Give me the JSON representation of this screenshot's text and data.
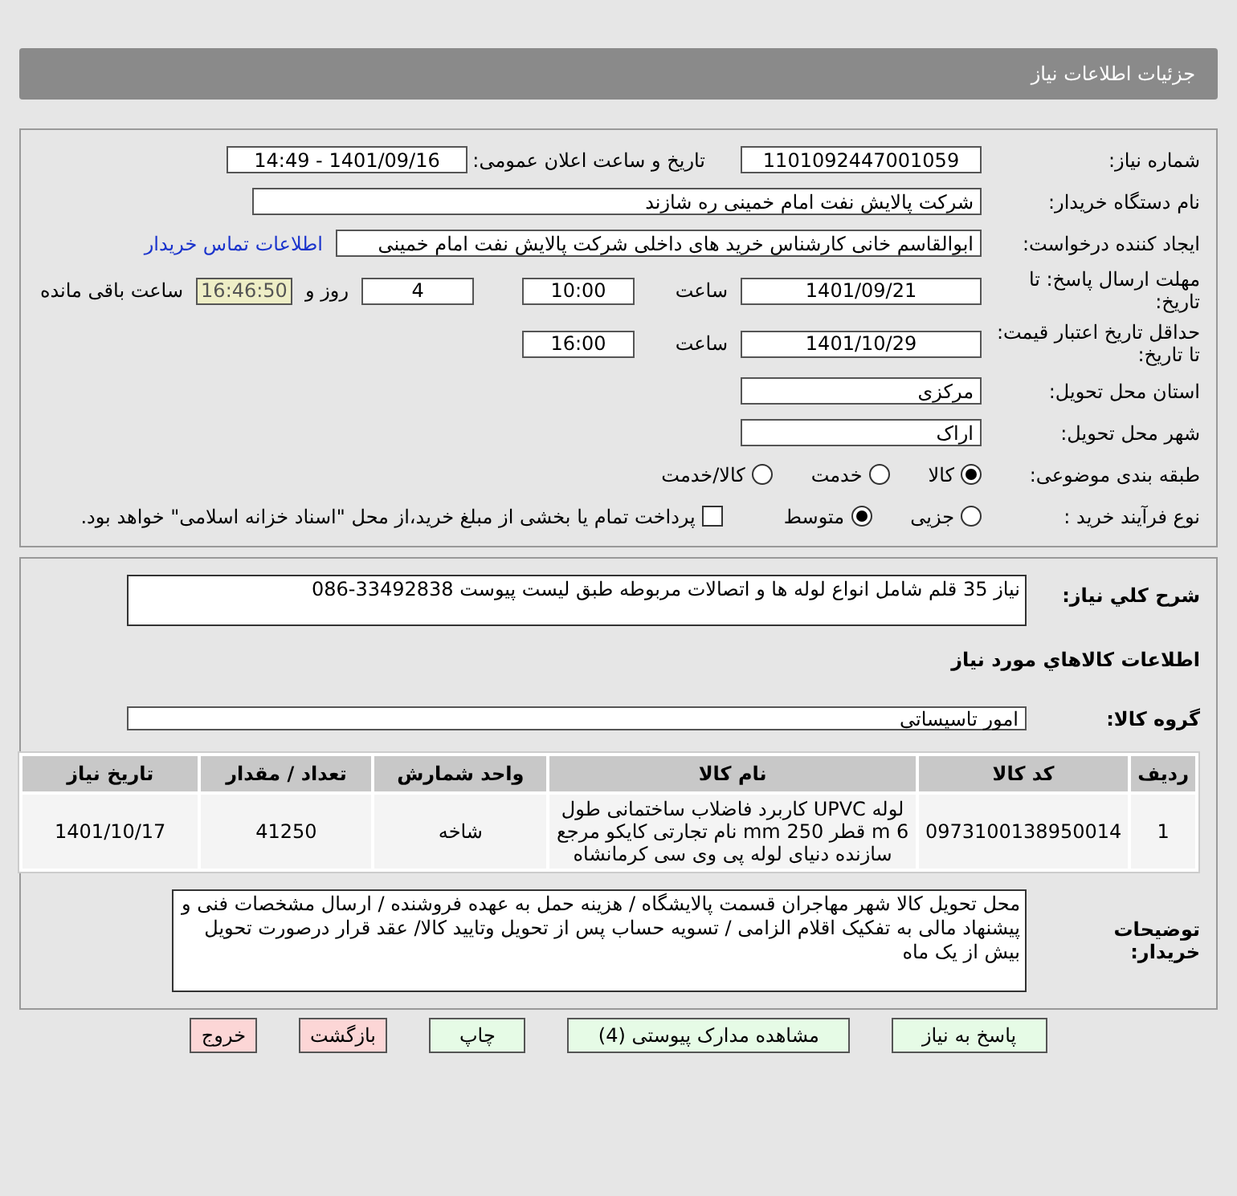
{
  "header": {
    "title": "جزئیات اطلاعات نیاز"
  },
  "need_number": {
    "label": "شماره نیاز:",
    "value": "1101092447001059"
  },
  "announce": {
    "label": "تاریخ و ساعت اعلان عمومی:",
    "value": "1401/09/16 - 14:49"
  },
  "buyer_org": {
    "label": "نام دستگاه خریدار:",
    "value": "شرکت پالایش نفت امام خمینی  ره  شازند"
  },
  "requester": {
    "label": "ایجاد کننده درخواست:",
    "value": "ابوالقاسم  خانی  کارشناس خرید های داخلی  شرکت پالایش نفت امام خمینی",
    "link": "اطلاعات تماس خریدار"
  },
  "deadline": {
    "label": "مهلت ارسال پاسخ: تا تاریخ:",
    "date": "1401/09/21",
    "time_label": "ساعت",
    "time": "10:00",
    "days": "4",
    "days_label": "روز و",
    "remaining": "16:46:50",
    "remaining_label": "ساعت باقی مانده"
  },
  "validity": {
    "label": "حداقل تاریخ اعتبار قیمت: تا تاریخ:",
    "date": "1401/10/29",
    "time_label": "ساعت",
    "time": "16:00"
  },
  "province": {
    "label": "استان محل تحویل:",
    "value": "مرکزی"
  },
  "city": {
    "label": "شهر محل تحویل:",
    "value": "اراک"
  },
  "category": {
    "label": "طبقه بندی موضوعی:",
    "options": [
      {
        "label": "کالا",
        "selected": true
      },
      {
        "label": "خدمت",
        "selected": false
      },
      {
        "label": "کالا/خدمت",
        "selected": false
      }
    ]
  },
  "process": {
    "label": "نوع فرآیند خرید :",
    "options": [
      {
        "label": "جزیی",
        "selected": false
      },
      {
        "label": "متوسط",
        "selected": true
      }
    ],
    "treasury": {
      "label": "پرداخت تمام یا بخشی از مبلغ خرید،از محل \"اسناد خزانه اسلامی\" خواهد بود.",
      "checked": false
    }
  },
  "description": {
    "label": "شرح کلي نياز:",
    "value": "نیاز 35 قلم شامل انواع لوله ها و اتصالات مربوطه طبق لیست پیوست 33492838-086"
  },
  "goods_heading": "اطلاعات کالاهاي مورد نياز",
  "goods_group": {
    "label": "گروه کالا:",
    "value": "امور تاسیساتی"
  },
  "table": {
    "columns": [
      "ردیف",
      "کد کالا",
      "نام کالا",
      "واحد شمارش",
      "تعداد / مقدار",
      "تاریخ نیاز"
    ],
    "rows": [
      [
        "1",
        "0973100138950014",
        "لوله UPVC کاربرد فاضلاب ساختمانی طول 6 m قطر 250 mm نام تجارتی کایکو مرجع سازنده دنیای لوله پی وی سی کرمانشاه",
        "شاخه",
        "41250",
        "1401/10/17"
      ]
    ]
  },
  "notes": {
    "label": "توضیحات خریدار:",
    "value": "محل تحویل کالا شهر مهاجران  قسمت پالایشگاه / هزینه حمل به عهده فروشنده / ارسال مشخصات فنی و پیشنهاد مالی به تفکیک اقلام الزامی / تسویه حساب پس از تحویل وتایید کالا/ عقد قرار درصورت تحویل بیش از یک ماه"
  },
  "buttons": [
    {
      "label": "پاسخ به نیاز",
      "kind": "normal"
    },
    {
      "label": "مشاهده مدارک پیوستی (4)",
      "kind": "normal"
    },
    {
      "label": "چاپ",
      "kind": "normal"
    },
    {
      "label": "بازگشت",
      "kind": "danger"
    },
    {
      "label": "خروج",
      "kind": "danger"
    }
  ]
}
